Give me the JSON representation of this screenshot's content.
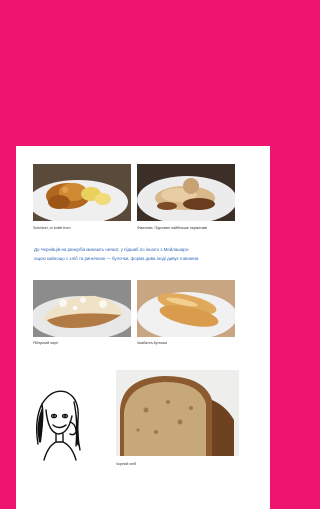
{
  "page": {
    "background_color": "#ee1470",
    "paper_color": "#ffffff",
    "text_color": "#2f67b8"
  },
  "photos": [
    {
      "name": "chicken-schnitzel",
      "caption": "Schnitzel, or kotlet from"
    },
    {
      "name": "meat-dish",
      "caption": "Фізичним. Підставні найбільше пиріжечків"
    },
    {
      "name": "strudel",
      "caption": "Яблучний пиріг"
    },
    {
      "name": "bread-rolls",
      "caption": "Чиабатта-булочки"
    },
    {
      "name": "rye-bread",
      "caption": "Чорний хліб"
    }
  ],
  "paragraph": {
    "line1": "До Чернівців-на ринку/ба минають неякої, у підшиб по іншого з Мейлашаро-",
    "line2": "ощою кайнощо с хліб та ринкічною — булочки, форма дива іноді дивує Іоаннина"
  },
  "illustration": {
    "name": "girl-character-drawing"
  }
}
